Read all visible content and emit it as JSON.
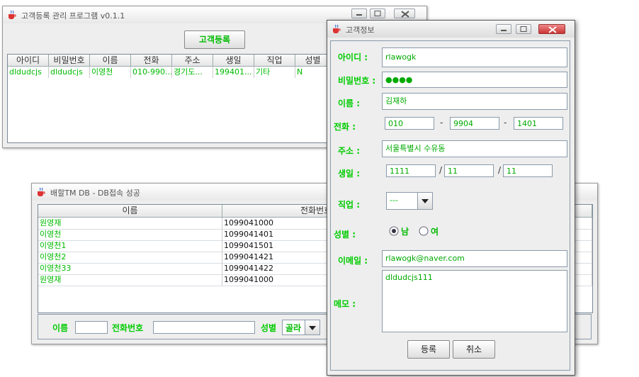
{
  "win1": {
    "title": "고객등록 관리 프로그램 v0.1.1",
    "register_button": "고객등록",
    "columns": [
      "아이디",
      "비밀번호",
      "이름",
      "전화",
      "주소",
      "생일",
      "직업",
      "성별"
    ],
    "rows": [
      [
        "dldudcjs",
        "dldudcjs",
        "이영천",
        "010-990...",
        "경기도...",
        "199401...",
        "기타",
        "N"
      ]
    ]
  },
  "win2": {
    "title": "배할TM DB - DB접속 성공",
    "columns": [
      "이름",
      "전화번호"
    ],
    "rows": [
      [
        "원영재",
        "1099041000"
      ],
      [
        "이영천",
        "1099041401"
      ],
      [
        "이영천1",
        "1099041501"
      ],
      [
        "이영천2",
        "1099041421"
      ],
      [
        "이영천33",
        "1099041422"
      ],
      [
        "원영재",
        "1099041000"
      ]
    ],
    "filter": {
      "name_label": "이름",
      "name_value": "",
      "phone_label": "전화번호",
      "phone_value": "",
      "gender_label": "성별",
      "gender_value": "골라"
    }
  },
  "dialog": {
    "title": "고객정보",
    "labels": {
      "id": "아이디 :",
      "password": "비밀번호 :",
      "name": "이름 :",
      "phone": "전화 :",
      "address": "주소 :",
      "birthday": "생일 :",
      "job": "직업 :",
      "gender": "성별 :",
      "email": "이메일 :",
      "memo": "메모 :"
    },
    "values": {
      "id": "rlawogk",
      "password": "●●●●",
      "name": "김재하",
      "phone1": "010",
      "phone2": "9904",
      "phone3": "1401",
      "address": "서울특별시 수유동",
      "birth1": "1111",
      "birth2": "11",
      "birth3": "11",
      "job": "---",
      "email": "rlawogk@naver.com",
      "memo": "dldudcjs111"
    },
    "phone_sep": "-",
    "birth_sep": "/",
    "gender_options": [
      "남",
      "여"
    ],
    "gender_selected": "남",
    "register_button": "등록",
    "cancel_button": "취소"
  },
  "colors": {
    "accent_text": "#00cc00",
    "border": "#8a9aaa",
    "window_bg": "#eeeeee"
  },
  "icons": [
    "java-cup-icon",
    "minimize-icon",
    "maximize-icon",
    "close-icon",
    "dropdown-arrow-icon"
  ]
}
